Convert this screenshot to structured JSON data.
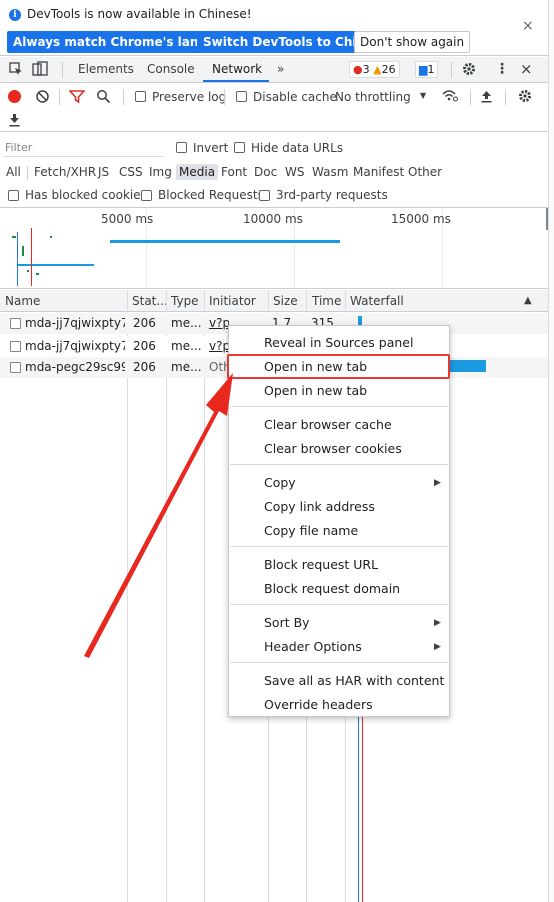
{
  "infobar": {
    "message": "DevTools is now available in Chinese!",
    "btn_match": "Always match Chrome's language",
    "btn_switch": "Switch DevTools to Chinese",
    "btn_dont_show": "Don't show again",
    "close": "×"
  },
  "tabs": {
    "elements": "Elements",
    "console": "Console",
    "network": "Network",
    "more": "»",
    "errors": "3",
    "warnings": "26",
    "messages": "1",
    "menu": "⋮",
    "close": "×"
  },
  "toolbar": {
    "preserve_log": "Preserve log",
    "disable_cache": "Disable cache",
    "throttling": "No throttling",
    "throttle_arrow": "▼"
  },
  "filter": {
    "placeholder": "Filter",
    "invert": "Invert",
    "hide_data_urls": "Hide data URLs",
    "types": [
      "All",
      "Fetch/XHR",
      "JS",
      "CSS",
      "Img",
      "Media",
      "Font",
      "Doc",
      "WS",
      "Wasm",
      "Manifest",
      "Other"
    ],
    "active_type": "Media",
    "has_blocked_cookies": "Has blocked cookies",
    "blocked_requests": "Blocked Requests",
    "third_party": "3rd-party requests"
  },
  "overview": {
    "ticks": [
      "5000 ms",
      "10000 ms",
      "15000 ms"
    ]
  },
  "table": {
    "headers": {
      "name": "Name",
      "status": "Stat...",
      "type": "Type",
      "initiator": "Initiator",
      "size": "Size",
      "time": "Time",
      "waterfall": "Waterfall",
      "sort": "▲"
    },
    "rows": [
      {
        "name": "mda-jj7qjwixpty7...",
        "status": "206",
        "type": "me...",
        "initiator": "v?pd=wi...",
        "size": "1.7...",
        "time": "315..."
      },
      {
        "name": "mda-jj7qjwixpty7...",
        "status": "206",
        "type": "me...",
        "initiator": "v?p",
        "size": "",
        "time": ""
      },
      {
        "name": "mda-pegc29sc99...",
        "status": "206",
        "type": "me...",
        "initiator": "Oth",
        "size": "",
        "time": ""
      }
    ]
  },
  "context_menu": {
    "reveal": "Reveal in Sources panel",
    "open_new_tab_1": "Open in new tab",
    "open_new_tab_2": "Open in new tab",
    "clear_cache": "Clear browser cache",
    "clear_cookies": "Clear browser cookies",
    "copy": "Copy",
    "copy_link": "Copy link address",
    "copy_file_name": "Copy file name",
    "block_url": "Block request URL",
    "block_domain": "Block request domain",
    "sort_by": "Sort By",
    "header_options": "Header Options",
    "save_har": "Save all as HAR with content",
    "override_headers": "Override headers",
    "submenu_arrow": "▶"
  },
  "colors": {
    "accent": "#1a73e8",
    "record": "#e8271f",
    "highlight_border": "#e53935",
    "arrow": "#e8271f"
  }
}
